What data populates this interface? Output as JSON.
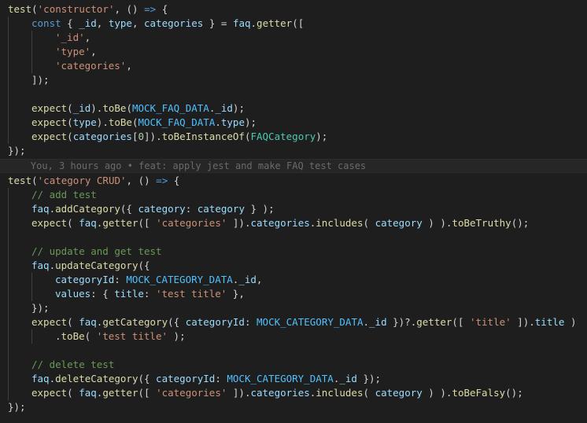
{
  "editor": {
    "colors": {
      "background": "#1e1e1e",
      "plain": "#d4d4d4",
      "function": "#dcdcaa",
      "string": "#ce9178",
      "keyword": "#569cd6",
      "variable": "#9cdcfe",
      "constant": "#4fc1ff",
      "class": "#4ec9b0",
      "comment": "#6a9955",
      "number": "#b5cea8",
      "blame": "#6b6b6b"
    },
    "lines": [
      {
        "indent": 0,
        "tokens": [
          [
            "test",
            "function"
          ],
          [
            "(",
            "plain"
          ],
          [
            "'constructor'",
            "string"
          ],
          [
            ", () ",
            "plain"
          ],
          [
            "=>",
            "keyword"
          ],
          [
            " {",
            "plain"
          ]
        ]
      },
      {
        "indent": 1,
        "tokens": [
          [
            "const",
            "keyword"
          ],
          [
            " { ",
            "plain"
          ],
          [
            "_id",
            "variable"
          ],
          [
            ", ",
            "plain"
          ],
          [
            "type",
            "variable"
          ],
          [
            ", ",
            "plain"
          ],
          [
            "categories",
            "variable"
          ],
          [
            " } = ",
            "plain"
          ],
          [
            "faq",
            "variable"
          ],
          [
            ".",
            "plain"
          ],
          [
            "getter",
            "function"
          ],
          [
            "([",
            "plain"
          ]
        ]
      },
      {
        "indent": 2,
        "tokens": [
          [
            "'_id'",
            "string"
          ],
          [
            ",",
            "plain"
          ]
        ]
      },
      {
        "indent": 2,
        "tokens": [
          [
            "'type'",
            "string"
          ],
          [
            ",",
            "plain"
          ]
        ]
      },
      {
        "indent": 2,
        "tokens": [
          [
            "'categories'",
            "string"
          ],
          [
            ",",
            "plain"
          ]
        ]
      },
      {
        "indent": 1,
        "tokens": [
          [
            "]);",
            "plain"
          ]
        ]
      },
      {
        "indent": 1,
        "tokens": []
      },
      {
        "indent": 1,
        "tokens": [
          [
            "expect",
            "function"
          ],
          [
            "(",
            "plain"
          ],
          [
            "_id",
            "variable"
          ],
          [
            ").",
            "plain"
          ],
          [
            "toBe",
            "function"
          ],
          [
            "(",
            "plain"
          ],
          [
            "MOCK_FAQ_DATA",
            "constant"
          ],
          [
            ".",
            "plain"
          ],
          [
            "_id",
            "variable"
          ],
          [
            ");",
            "plain"
          ]
        ]
      },
      {
        "indent": 1,
        "tokens": [
          [
            "expect",
            "function"
          ],
          [
            "(",
            "plain"
          ],
          [
            "type",
            "variable"
          ],
          [
            ").",
            "plain"
          ],
          [
            "toBe",
            "function"
          ],
          [
            "(",
            "plain"
          ],
          [
            "MOCK_FAQ_DATA",
            "constant"
          ],
          [
            ".",
            "plain"
          ],
          [
            "type",
            "variable"
          ],
          [
            ");",
            "plain"
          ]
        ]
      },
      {
        "indent": 1,
        "tokens": [
          [
            "expect",
            "function"
          ],
          [
            "(",
            "plain"
          ],
          [
            "categories",
            "variable"
          ],
          [
            "[",
            "plain"
          ],
          [
            "0",
            "number"
          ],
          [
            "]).",
            "plain"
          ],
          [
            "toBeInstanceOf",
            "function"
          ],
          [
            "(",
            "plain"
          ],
          [
            "FAQCategory",
            "class"
          ],
          [
            ");",
            "plain"
          ]
        ]
      },
      {
        "indent": 0,
        "tokens": [
          [
            "});",
            "plain"
          ]
        ]
      },
      {
        "indent": 0,
        "blame": true,
        "tokens": [
          [
            "    You, 3 hours ago • feat: apply jest and make FAQ test cases",
            "blame"
          ]
        ]
      },
      {
        "indent": 0,
        "tokens": [
          [
            "test",
            "function"
          ],
          [
            "(",
            "plain"
          ],
          [
            "'category CRUD'",
            "string"
          ],
          [
            ", () ",
            "plain"
          ],
          [
            "=>",
            "keyword"
          ],
          [
            " {",
            "plain"
          ]
        ]
      },
      {
        "indent": 1,
        "tokens": [
          [
            "// add test",
            "comment"
          ]
        ]
      },
      {
        "indent": 1,
        "tokens": [
          [
            "faq",
            "variable"
          ],
          [
            ".",
            "plain"
          ],
          [
            "addCategory",
            "function"
          ],
          [
            "({ ",
            "plain"
          ],
          [
            "category",
            "variable"
          ],
          [
            ": ",
            "plain"
          ],
          [
            "category",
            "variable"
          ],
          [
            " } );",
            "plain"
          ]
        ]
      },
      {
        "indent": 1,
        "tokens": [
          [
            "expect",
            "function"
          ],
          [
            "( ",
            "plain"
          ],
          [
            "faq",
            "variable"
          ],
          [
            ".",
            "plain"
          ],
          [
            "getter",
            "function"
          ],
          [
            "([ ",
            "plain"
          ],
          [
            "'categories'",
            "string"
          ],
          [
            " ]).",
            "plain"
          ],
          [
            "categories",
            "variable"
          ],
          [
            ".",
            "plain"
          ],
          [
            "includes",
            "function"
          ],
          [
            "( ",
            "plain"
          ],
          [
            "category",
            "variable"
          ],
          [
            " ) ).",
            "plain"
          ],
          [
            "toBeTruthy",
            "function"
          ],
          [
            "();",
            "plain"
          ]
        ]
      },
      {
        "indent": 1,
        "tokens": []
      },
      {
        "indent": 1,
        "tokens": [
          [
            "// update and get test",
            "comment"
          ]
        ]
      },
      {
        "indent": 1,
        "tokens": [
          [
            "faq",
            "variable"
          ],
          [
            ".",
            "plain"
          ],
          [
            "updateCategory",
            "function"
          ],
          [
            "({",
            "plain"
          ]
        ]
      },
      {
        "indent": 2,
        "tokens": [
          [
            "categoryId",
            "variable"
          ],
          [
            ": ",
            "plain"
          ],
          [
            "MOCK_CATEGORY_DATA",
            "constant"
          ],
          [
            ".",
            "plain"
          ],
          [
            "_id",
            "variable"
          ],
          [
            ",",
            "plain"
          ]
        ]
      },
      {
        "indent": 2,
        "tokens": [
          [
            "values",
            "variable"
          ],
          [
            ": { ",
            "plain"
          ],
          [
            "title",
            "variable"
          ],
          [
            ": ",
            "plain"
          ],
          [
            "'test title'",
            "string"
          ],
          [
            " },",
            "plain"
          ]
        ]
      },
      {
        "indent": 1,
        "tokens": [
          [
            "});",
            "plain"
          ]
        ]
      },
      {
        "indent": 1,
        "tokens": [
          [
            "expect",
            "function"
          ],
          [
            "( ",
            "plain"
          ],
          [
            "faq",
            "variable"
          ],
          [
            ".",
            "plain"
          ],
          [
            "getCategory",
            "function"
          ],
          [
            "({ ",
            "plain"
          ],
          [
            "categoryId",
            "variable"
          ],
          [
            ": ",
            "plain"
          ],
          [
            "MOCK_CATEGORY_DATA",
            "constant"
          ],
          [
            ".",
            "plain"
          ],
          [
            "_id",
            "variable"
          ],
          [
            " })?.",
            "plain"
          ],
          [
            "getter",
            "function"
          ],
          [
            "([ ",
            "plain"
          ],
          [
            "'title'",
            "string"
          ],
          [
            " ]).",
            "plain"
          ],
          [
            "title",
            "variable"
          ],
          [
            " )",
            "plain"
          ]
        ]
      },
      {
        "indent": 2,
        "tokens": [
          [
            ".",
            "plain"
          ],
          [
            "toBe",
            "function"
          ],
          [
            "( ",
            "plain"
          ],
          [
            "'test title'",
            "string"
          ],
          [
            " );",
            "plain"
          ]
        ]
      },
      {
        "indent": 1,
        "tokens": []
      },
      {
        "indent": 1,
        "tokens": [
          [
            "// delete test",
            "comment"
          ]
        ]
      },
      {
        "indent": 1,
        "tokens": [
          [
            "faq",
            "variable"
          ],
          [
            ".",
            "plain"
          ],
          [
            "deleteCategory",
            "function"
          ],
          [
            "({ ",
            "plain"
          ],
          [
            "categoryId",
            "variable"
          ],
          [
            ": ",
            "plain"
          ],
          [
            "MOCK_CATEGORY_DATA",
            "constant"
          ],
          [
            ".",
            "plain"
          ],
          [
            "_id",
            "variable"
          ],
          [
            " });",
            "plain"
          ]
        ]
      },
      {
        "indent": 1,
        "tokens": [
          [
            "expect",
            "function"
          ],
          [
            "( ",
            "plain"
          ],
          [
            "faq",
            "variable"
          ],
          [
            ".",
            "plain"
          ],
          [
            "getter",
            "function"
          ],
          [
            "([ ",
            "plain"
          ],
          [
            "'categories'",
            "string"
          ],
          [
            " ]).",
            "plain"
          ],
          [
            "categories",
            "variable"
          ],
          [
            ".",
            "plain"
          ],
          [
            "includes",
            "function"
          ],
          [
            "( ",
            "plain"
          ],
          [
            "category",
            "variable"
          ],
          [
            " ) ).",
            "plain"
          ],
          [
            "toBeFalsy",
            "function"
          ],
          [
            "();",
            "plain"
          ]
        ]
      },
      {
        "indent": 0,
        "tokens": [
          [
            "});",
            "plain"
          ]
        ]
      }
    ]
  }
}
